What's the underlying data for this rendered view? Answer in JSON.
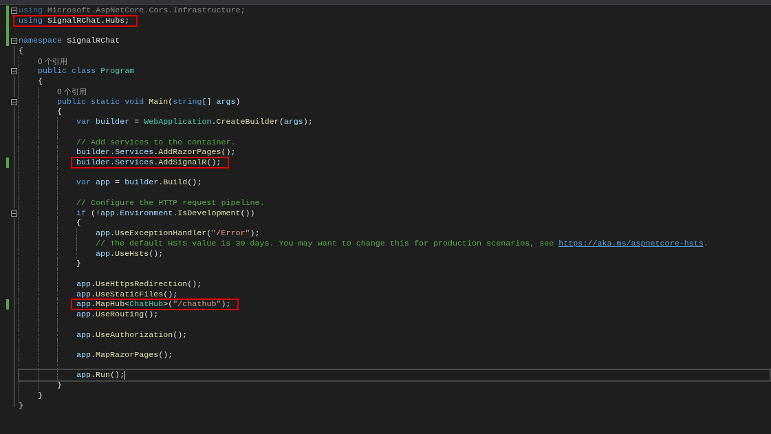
{
  "editor": {
    "lines": [
      {
        "kind": "code",
        "expanded": true,
        "changed": true,
        "tokens": [
          {
            "kind": "dimkw",
            "text": "using"
          },
          {
            "kind": "dim",
            "text": " Microsoft.AspNetCore.Cors.Infrastructure;"
          }
        ]
      },
      {
        "kind": "code",
        "changed": true,
        "highlighted": true,
        "tokens": [
          {
            "kind": "kw",
            "text": "using"
          },
          {
            "kind": "plain",
            "text": " SignalRChat.Hubs;"
          }
        ]
      },
      {
        "kind": "blank",
        "changed": true
      },
      {
        "kind": "code",
        "expanded": true,
        "changed": true,
        "tokens": [
          {
            "kind": "kw",
            "text": "namespace"
          },
          {
            "kind": "plain",
            "text": " SignalRChat"
          }
        ]
      },
      {
        "kind": "code",
        "tokens": [
          {
            "kind": "plain",
            "text": "{"
          }
        ],
        "children": [
          {
            "kind": "lens",
            "text": "0 个引用"
          },
          {
            "kind": "code",
            "expanded": true,
            "tokens": [
              {
                "kind": "kw",
                "text": "public class "
              },
              {
                "kind": "type",
                "text": "Program"
              }
            ]
          },
          {
            "kind": "code",
            "tokens": [
              {
                "kind": "plain",
                "text": "{"
              }
            ],
            "children": [
              {
                "kind": "lens",
                "text": "0 个引用"
              },
              {
                "kind": "code",
                "expanded": true,
                "tokens": [
                  {
                    "kind": "kw",
                    "text": "public static void "
                  },
                  {
                    "kind": "fn",
                    "text": "Main"
                  },
                  {
                    "kind": "plain",
                    "text": "("
                  },
                  {
                    "kind": "kw",
                    "text": "string"
                  },
                  {
                    "kind": "plain",
                    "text": "[] "
                  },
                  {
                    "kind": "id",
                    "text": "args"
                  },
                  {
                    "kind": "plain",
                    "text": ")"
                  }
                ]
              },
              {
                "kind": "code",
                "tokens": [
                  {
                    "kind": "plain",
                    "text": "{"
                  }
                ],
                "children": [
                  {
                    "kind": "code",
                    "tokens": [
                      {
                        "kind": "kw",
                        "text": "var "
                      },
                      {
                        "kind": "id",
                        "text": "builder"
                      },
                      {
                        "kind": "plain",
                        "text": " = "
                      },
                      {
                        "kind": "type",
                        "text": "WebApplication"
                      },
                      {
                        "kind": "plain",
                        "text": "."
                      },
                      {
                        "kind": "fn",
                        "text": "CreateBuilder"
                      },
                      {
                        "kind": "plain",
                        "text": "("
                      },
                      {
                        "kind": "id",
                        "text": "args"
                      },
                      {
                        "kind": "plain",
                        "text": ");"
                      }
                    ]
                  },
                  {
                    "kind": "blank"
                  },
                  {
                    "kind": "code",
                    "tokens": [
                      {
                        "kind": "cmt",
                        "text": "// Add services to the container."
                      }
                    ]
                  },
                  {
                    "kind": "code",
                    "tokens": [
                      {
                        "kind": "id",
                        "text": "builder"
                      },
                      {
                        "kind": "plain",
                        "text": "."
                      },
                      {
                        "kind": "id",
                        "text": "Services"
                      },
                      {
                        "kind": "plain",
                        "text": "."
                      },
                      {
                        "kind": "fn",
                        "text": "AddRazorPages"
                      },
                      {
                        "kind": "plain",
                        "text": "();"
                      }
                    ]
                  },
                  {
                    "kind": "code",
                    "changed": true,
                    "highlighted": true,
                    "tokens": [
                      {
                        "kind": "id",
                        "text": "builder"
                      },
                      {
                        "kind": "plain",
                        "text": "."
                      },
                      {
                        "kind": "id",
                        "text": "Services"
                      },
                      {
                        "kind": "plain",
                        "text": "."
                      },
                      {
                        "kind": "fn",
                        "text": "AddSignalR"
                      },
                      {
                        "kind": "plain",
                        "text": "();"
                      }
                    ]
                  },
                  {
                    "kind": "blank"
                  },
                  {
                    "kind": "code",
                    "tokens": [
                      {
                        "kind": "kw",
                        "text": "var "
                      },
                      {
                        "kind": "id",
                        "text": "app"
                      },
                      {
                        "kind": "plain",
                        "text": " = "
                      },
                      {
                        "kind": "id",
                        "text": "builder"
                      },
                      {
                        "kind": "plain",
                        "text": "."
                      },
                      {
                        "kind": "fn",
                        "text": "Build"
                      },
                      {
                        "kind": "plain",
                        "text": "();"
                      }
                    ]
                  },
                  {
                    "kind": "blank"
                  },
                  {
                    "kind": "code",
                    "tokens": [
                      {
                        "kind": "cmt",
                        "text": "// Configure the HTTP request pipeline."
                      }
                    ]
                  },
                  {
                    "kind": "code",
                    "expanded": true,
                    "tokens": [
                      {
                        "kind": "kw",
                        "text": "if"
                      },
                      {
                        "kind": "plain",
                        "text": " (!"
                      },
                      {
                        "kind": "id",
                        "text": "app"
                      },
                      {
                        "kind": "plain",
                        "text": "."
                      },
                      {
                        "kind": "id",
                        "text": "Environment"
                      },
                      {
                        "kind": "plain",
                        "text": "."
                      },
                      {
                        "kind": "fn",
                        "text": "IsDevelopment"
                      },
                      {
                        "kind": "plain",
                        "text": "())"
                      }
                    ]
                  },
                  {
                    "kind": "code",
                    "tokens": [
                      {
                        "kind": "plain",
                        "text": "{"
                      }
                    ],
                    "children": [
                      {
                        "kind": "code",
                        "tokens": [
                          {
                            "kind": "id",
                            "text": "app"
                          },
                          {
                            "kind": "plain",
                            "text": "."
                          },
                          {
                            "kind": "fn",
                            "text": "UseExceptionHandler"
                          },
                          {
                            "kind": "plain",
                            "text": "("
                          },
                          {
                            "kind": "str",
                            "text": "\"/Error\""
                          },
                          {
                            "kind": "plain",
                            "text": ");"
                          }
                        ]
                      },
                      {
                        "kind": "code",
                        "tokens": [
                          {
                            "kind": "cmt",
                            "text": "// The default HSTS value is 30 days. You may want to change this for production scenarios, see "
                          },
                          {
                            "kind": "link",
                            "text": "https://aka.ms/aspnetcore-hsts"
                          },
                          {
                            "kind": "cmt",
                            "text": "."
                          }
                        ]
                      },
                      {
                        "kind": "code",
                        "tokens": [
                          {
                            "kind": "id",
                            "text": "app"
                          },
                          {
                            "kind": "plain",
                            "text": "."
                          },
                          {
                            "kind": "fn",
                            "text": "UseHsts"
                          },
                          {
                            "kind": "plain",
                            "text": "();"
                          }
                        ]
                      }
                    ]
                  },
                  {
                    "kind": "code",
                    "tokens": [
                      {
                        "kind": "plain",
                        "text": "}"
                      }
                    ]
                  },
                  {
                    "kind": "blank"
                  },
                  {
                    "kind": "code",
                    "tokens": [
                      {
                        "kind": "id",
                        "text": "app"
                      },
                      {
                        "kind": "plain",
                        "text": "."
                      },
                      {
                        "kind": "fn",
                        "text": "UseHttpsRedirection"
                      },
                      {
                        "kind": "plain",
                        "text": "();"
                      }
                    ]
                  },
                  {
                    "kind": "code",
                    "tokens": [
                      {
                        "kind": "id",
                        "text": "app"
                      },
                      {
                        "kind": "plain",
                        "text": "."
                      },
                      {
                        "kind": "fn",
                        "text": "UseStaticFiles"
                      },
                      {
                        "kind": "plain",
                        "text": "();"
                      }
                    ]
                  },
                  {
                    "kind": "code",
                    "changed": true,
                    "highlighted": true,
                    "tokens": [
                      {
                        "kind": "id",
                        "text": "app"
                      },
                      {
                        "kind": "plain",
                        "text": "."
                      },
                      {
                        "kind": "fn",
                        "text": "MapHub"
                      },
                      {
                        "kind": "plain",
                        "text": "<"
                      },
                      {
                        "kind": "type",
                        "text": "ChatHub"
                      },
                      {
                        "kind": "plain",
                        "text": ">("
                      },
                      {
                        "kind": "str",
                        "text": "\"/chathub\""
                      },
                      {
                        "kind": "plain",
                        "text": ");"
                      }
                    ]
                  },
                  {
                    "kind": "code",
                    "tokens": [
                      {
                        "kind": "id",
                        "text": "app"
                      },
                      {
                        "kind": "plain",
                        "text": "."
                      },
                      {
                        "kind": "fn",
                        "text": "UseRouting"
                      },
                      {
                        "kind": "plain",
                        "text": "();"
                      }
                    ]
                  },
                  {
                    "kind": "blank"
                  },
                  {
                    "kind": "code",
                    "tokens": [
                      {
                        "kind": "id",
                        "text": "app"
                      },
                      {
                        "kind": "plain",
                        "text": "."
                      },
                      {
                        "kind": "fn",
                        "text": "UseAuthorization"
                      },
                      {
                        "kind": "plain",
                        "text": "();"
                      }
                    ]
                  },
                  {
                    "kind": "blank"
                  },
                  {
                    "kind": "code",
                    "tokens": [
                      {
                        "kind": "id",
                        "text": "app"
                      },
                      {
                        "kind": "plain",
                        "text": "."
                      },
                      {
                        "kind": "fn",
                        "text": "MapRazorPages"
                      },
                      {
                        "kind": "plain",
                        "text": "();"
                      }
                    ]
                  },
                  {
                    "kind": "blank"
                  },
                  {
                    "kind": "code",
                    "current": true,
                    "tokens": [
                      {
                        "kind": "id",
                        "text": "app"
                      },
                      {
                        "kind": "plain",
                        "text": "."
                      },
                      {
                        "kind": "fn",
                        "text": "Run"
                      },
                      {
                        "kind": "plain",
                        "text": "();"
                      }
                    ]
                  }
                ]
              },
              {
                "kind": "code",
                "tokens": [
                  {
                    "kind": "plain",
                    "text": "}"
                  }
                ]
              }
            ]
          },
          {
            "kind": "code",
            "tokens": [
              {
                "kind": "plain",
                "text": "}"
              }
            ]
          }
        ]
      },
      {
        "kind": "code",
        "tokens": [
          {
            "kind": "plain",
            "text": "}"
          }
        ]
      }
    ]
  }
}
